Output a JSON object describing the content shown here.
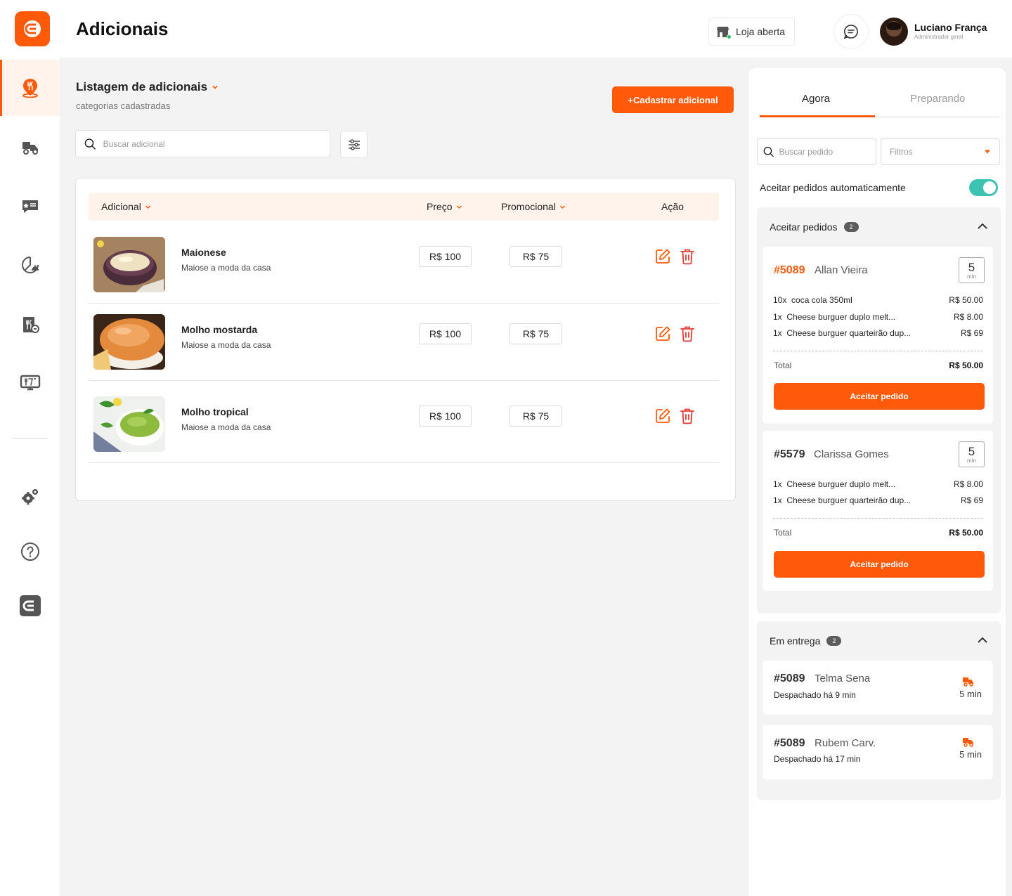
{
  "header": {
    "title": "Adicionais",
    "store_status": "Loja aberta",
    "user": {
      "name": "Luciano França",
      "role": "Administrador geral"
    }
  },
  "sidebar": {
    "items": [
      {
        "icon": "store-location-icon",
        "active": true
      },
      {
        "icon": "delivery-truck-icon",
        "active": false
      },
      {
        "icon": "promo-menu-icon",
        "active": false
      },
      {
        "icon": "reports-chart-icon",
        "active": false
      },
      {
        "icon": "menu-book-icon",
        "active": false
      },
      {
        "icon": "tv-menu-icon",
        "active": false
      },
      {
        "icon": "settings-gears-icon",
        "active": false
      },
      {
        "icon": "help-icon",
        "active": false
      },
      {
        "icon": "brand-logo-icon",
        "active": false
      }
    ]
  },
  "main": {
    "list_title": "Listagem de adicionais",
    "list_subtitle": "categorias cadastradas",
    "add_button": "+Cadastrar adicional",
    "search_placeholder": "Buscar adicional",
    "table": {
      "columns": [
        "Adicional",
        "Preço",
        "Promocional",
        "Ação"
      ],
      "rows": [
        {
          "name": "Maionese",
          "description": "Maiose a moda da casa",
          "price": "R$ 100",
          "promo": "R$ 75"
        },
        {
          "name": "Molho mostarda",
          "description": "Maiose a moda da casa",
          "price": "R$ 100",
          "promo": "R$ 75"
        },
        {
          "name": "Molho tropical",
          "description": "Maiose a moda da casa",
          "price": "R$ 100",
          "promo": "R$ 75"
        }
      ]
    }
  },
  "panel": {
    "tabs": [
      "Agora",
      "Preparando"
    ],
    "search_placeholder": "Buscar pedido",
    "filter_label": "Filtros",
    "auto_accept_label": "Aceitar pedidos automaticamente",
    "auto_accept_on": true,
    "accept_group": {
      "title": "Aceitar pedidos",
      "count": "2",
      "orders": [
        {
          "id": "#5089",
          "customer": "Allan Vieira",
          "minutes": "5",
          "unit": "min",
          "items": [
            {
              "qty": "10x",
              "name": "coca cola 350ml",
              "price": "R$ 50.00"
            },
            {
              "qty": "1x",
              "name": "Cheese burguer duplo melt...",
              "price": "R$ 8.00"
            },
            {
              "qty": "1x",
              "name": "Cheese burguer quarteirão dup...",
              "price": "R$ 69"
            }
          ],
          "total_label": "Total",
          "total": "R$ 50.00",
          "button": "Aceitar pedido"
        },
        {
          "id": "#5579",
          "customer": "Clarissa Gomes",
          "minutes": "5",
          "unit": "min",
          "items": [
            {
              "qty": "1x",
              "name": "Cheese burguer duplo melt...",
              "price": "R$ 8.00"
            },
            {
              "qty": "1x",
              "name": "Cheese burguer quarteirão dup...",
              "price": "R$ 69"
            }
          ],
          "total_label": "Total",
          "total": "R$ 50.00",
          "button": "Aceitar pedido"
        }
      ]
    },
    "delivery_group": {
      "title": "Em entrega",
      "count": "2",
      "orders": [
        {
          "id": "#5089",
          "customer": "Telma Sena",
          "status": "Despachado há 9 min",
          "time": "5 min"
        },
        {
          "id": "#5089",
          "customer": "Rubem Carv.",
          "status": "Despachado há 17 min",
          "time": "5 min"
        }
      ]
    }
  },
  "colors": {
    "accent": "#ff5a0a",
    "toggle": "#3cc3b2",
    "delete": "#e53935",
    "header_row": "#fff3eb"
  }
}
